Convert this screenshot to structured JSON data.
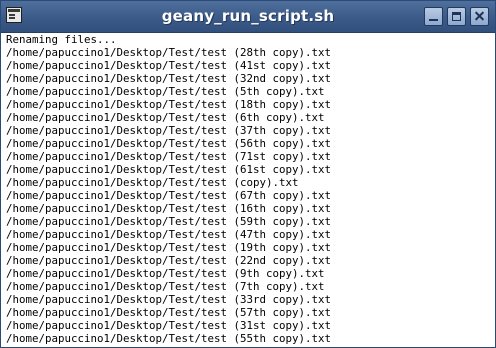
{
  "window": {
    "title": "geany_run_script.sh",
    "app_icon": "terminal-icon",
    "buttons": [
      "minimize-icon",
      "maximize-icon",
      "close-icon"
    ]
  },
  "terminal": {
    "lines": [
      "Renaming files...",
      "/home/papuccino1/Desktop/Test/test (28th copy).txt",
      "/home/papuccino1/Desktop/Test/test (41st copy).txt",
      "/home/papuccino1/Desktop/Test/test (32nd copy).txt",
      "/home/papuccino1/Desktop/Test/test (5th copy).txt",
      "/home/papuccino1/Desktop/Test/test (18th copy).txt",
      "/home/papuccino1/Desktop/Test/test (6th copy).txt",
      "/home/papuccino1/Desktop/Test/test (37th copy).txt",
      "/home/papuccino1/Desktop/Test/test (56th copy).txt",
      "/home/papuccino1/Desktop/Test/test (71st copy).txt",
      "/home/papuccino1/Desktop/Test/test (61st copy).txt",
      "/home/papuccino1/Desktop/Test/test (copy).txt",
      "/home/papuccino1/Desktop/Test/test (67th copy).txt",
      "/home/papuccino1/Desktop/Test/test (16th copy).txt",
      "/home/papuccino1/Desktop/Test/test (59th copy).txt",
      "/home/papuccino1/Desktop/Test/test (47th copy).txt",
      "/home/papuccino1/Desktop/Test/test (19th copy).txt",
      "/home/papuccino1/Desktop/Test/test (22nd copy).txt",
      "/home/papuccino1/Desktop/Test/test (9th copy).txt",
      "/home/papuccino1/Desktop/Test/test (7th copy).txt",
      "/home/papuccino1/Desktop/Test/test (33rd copy).txt",
      "/home/papuccino1/Desktop/Test/test (57th copy).txt",
      "/home/papuccino1/Desktop/Test/test (31st copy).txt",
      "/home/papuccino1/Desktop/Test/test (55th copy).txt"
    ]
  }
}
